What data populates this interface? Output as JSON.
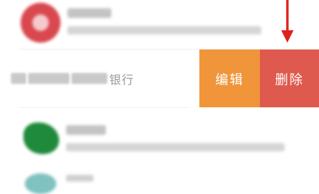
{
  "swipe_row": {
    "account_suffix": "银行",
    "actions": {
      "edit": "编辑",
      "delete": "删除"
    }
  },
  "colors": {
    "edit": "#F0953A",
    "delete": "#DF5A4E",
    "arrow": "#E0211B",
    "avatar_top": "#D9474F",
    "avatar_bottom": "#1F8A3C"
  },
  "icons": {
    "annotation_arrow": "down-arrow-icon"
  }
}
